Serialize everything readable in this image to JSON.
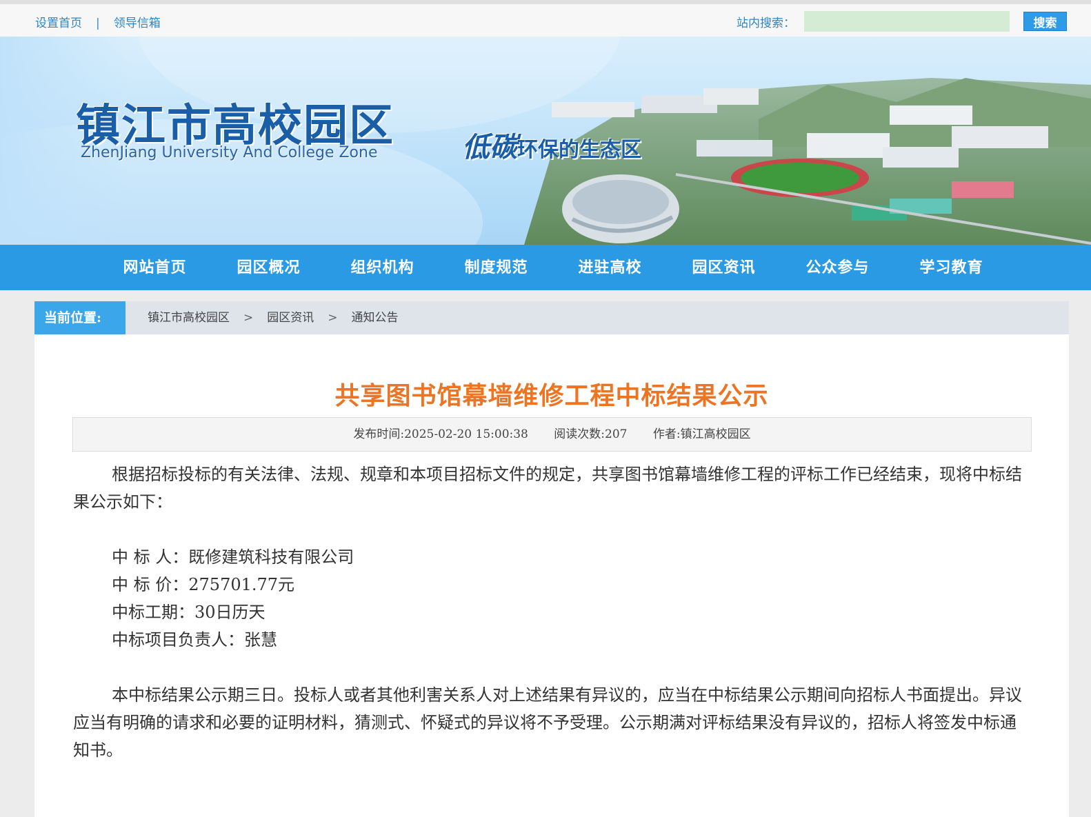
{
  "topbar": {
    "set_home": "设置首页",
    "separator": "|",
    "mailbox": "领导信箱",
    "search_label": "站内搜索：",
    "search_value": "",
    "search_button": "搜索"
  },
  "banner": {
    "logo_cn": "镇江市高校园区",
    "logo_en": "ZhenJiang University And College Zone",
    "slogan_big": "低碳",
    "slogan_rest": "环保的生态区"
  },
  "nav": {
    "items": [
      "网站首页",
      "园区概况",
      "组织机构",
      "制度规范",
      "进驻高校",
      "园区资讯",
      "公众参与",
      "学习教育"
    ]
  },
  "breadcrumb": {
    "label": "当前位置:",
    "items": [
      "镇江市高校园区",
      "园区资讯",
      "通知公告"
    ],
    "arrow": ">"
  },
  "article": {
    "title": "共享图书馆幕墙维修工程中标结果公示",
    "publish_time": "发布时间:2025-02-20 15:00:38",
    "read_count": "阅读次数:207",
    "author": "作者:镇江高校园区",
    "para1": "根据招标投标的有关法律、法规、规章和本项目招标文件的规定，共享图书馆幕墙维修工程的评标工作已经结束，现将中标结果公示如下：",
    "winner": "中 标 人：既修建筑科技有限公司",
    "price": "中 标 价：275701.77元",
    "duration": "中标工期：30日历天",
    "manager": "中标项目负责人：张慧",
    "para2": "本中标结果公示期三日。投标人或者其他利害关系人对上述结果有异议的，应当在中标结果公示期间向招标人书面提出。异议应当有明确的请求和必要的证明材料，猜测式、怀疑式的异议将不予受理。公示期满对评标结果没有异议的，招标人将签发中标通知书。"
  }
}
